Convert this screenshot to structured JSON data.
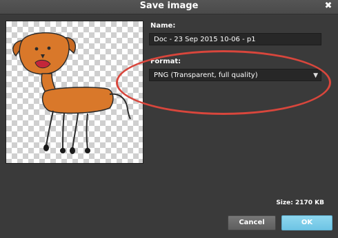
{
  "dialog": {
    "title": "Save image",
    "close_glyph": "✖"
  },
  "name_field": {
    "label": "Name:",
    "value": "Doc - 23 Sep 2015 10-06 - p1"
  },
  "format_field": {
    "label": "Format:",
    "value": "PNG (Transparent, full quality)",
    "arrow_glyph": "▼"
  },
  "size_text": "Size: 2170 KB",
  "buttons": {
    "cancel": "Cancel",
    "ok": "OK"
  },
  "colors": {
    "background": "#3a3a3a",
    "ok_button": "#7ccfe9",
    "highlight_ring": "#d8463c",
    "drawing_fill": "#d9782a"
  },
  "icons": {
    "close": "close-icon",
    "dropdown": "chevron-down-icon"
  }
}
